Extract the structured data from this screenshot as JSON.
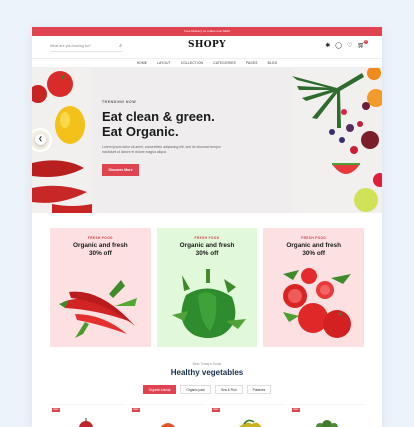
{
  "topbar": {
    "text": "Free Delivery on orders over $100"
  },
  "header": {
    "search_placeholder": "What are you looking for?",
    "logo": "SHOPY",
    "cart_count": "0"
  },
  "nav": [
    {
      "label": "HOME"
    },
    {
      "label": "LAYOUT"
    },
    {
      "label": "COLLECTION"
    },
    {
      "label": "CATEGORIES"
    },
    {
      "label": "PAGES"
    },
    {
      "label": "BLOG"
    }
  ],
  "hero": {
    "eyebrow": "TRENDING NOW",
    "headline_1": "Eat clean & green.",
    "headline_2": "Eat Organic.",
    "text": "Lorem ipsum dolor sit amet, consectetur adipiscing elit, sed do eiusmod tempor incididunt ut labore et dolore magna aliqua.",
    "button": "Discover More"
  },
  "cards": [
    {
      "tag": "FRESH FOOD",
      "title_1": "Organic and fresh",
      "title_2": "30% off",
      "bg": "#fde0e2"
    },
    {
      "tag": "FRESH FOOD",
      "title_1": "Organic and fresh",
      "title_2": "30% off",
      "bg": "#e2f8da"
    },
    {
      "tag": "FRESH FOOD",
      "title_1": "Organic and fresh",
      "title_2": "30% off",
      "bg": "#fde0e2"
    }
  ],
  "products": {
    "subtitle": "Best Today's Deals",
    "title": "Healthy vegetables",
    "tabs": [
      {
        "label": "Organic Animal",
        "active": true
      },
      {
        "label": "Organic juice",
        "active": false
      },
      {
        "label": "Sea & Fish",
        "active": false
      },
      {
        "label": "Potatoes",
        "active": false
      }
    ],
    "badges": [
      "New",
      "New",
      "New",
      "New"
    ]
  },
  "colors": {
    "accent": "#e04451",
    "heading": "#1a2f4d"
  }
}
